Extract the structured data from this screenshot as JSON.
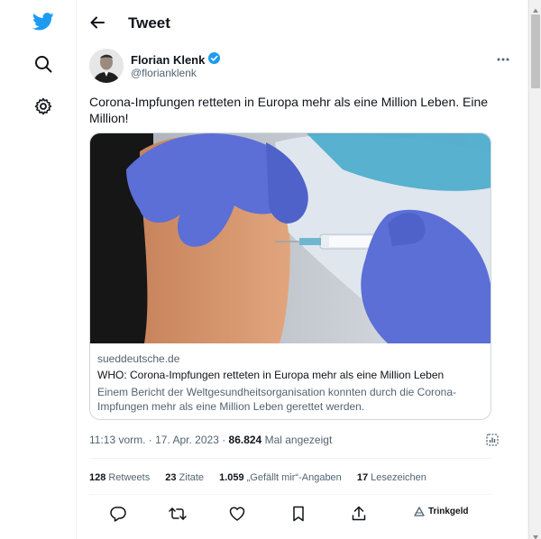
{
  "header": {
    "title": "Tweet"
  },
  "nav": {
    "items": [
      {
        "icon": "twitter-bird-icon"
      },
      {
        "icon": "search-icon"
      },
      {
        "icon": "gear-icon"
      }
    ]
  },
  "tweet": {
    "author_name": "Florian Klenk",
    "author_handle": "@florianklenk",
    "text": "Corona-Impfungen retteten in Europa mehr als eine Million Leben. Eine Million!",
    "card": {
      "domain": "sueddeutsche.de",
      "title": "WHO: Corona-Impfungen retteten in Europa mehr als eine Million Leben",
      "description": "Einem Bericht der Weltgesundheitsorganisation konnten durch die Corona-Impfungen mehr als eine Million Leben gerettet werden."
    },
    "timestamp": "11:13 vorm. · 17. Apr. 2023 · ",
    "views_count": "86.824",
    "views_label": " Mal angezeigt",
    "stats": {
      "retweets_count": "128",
      "retweets_label": "Retweets",
      "quotes_count": "23",
      "quotes_label": "Zitate",
      "likes_count": "1.059",
      "likes_label": "„Gefällt mir“-Angaben",
      "bookmarks_count": "17",
      "bookmarks_label": "Lesezeichen"
    },
    "actions": {
      "tip_label": "Trinkgeld"
    }
  },
  "colors": {
    "brand_blue": "#1d9bf0",
    "text_primary": "#0f1419",
    "text_secondary": "#536471",
    "border": "#cfd9de",
    "glove": "#5a6fd8"
  }
}
